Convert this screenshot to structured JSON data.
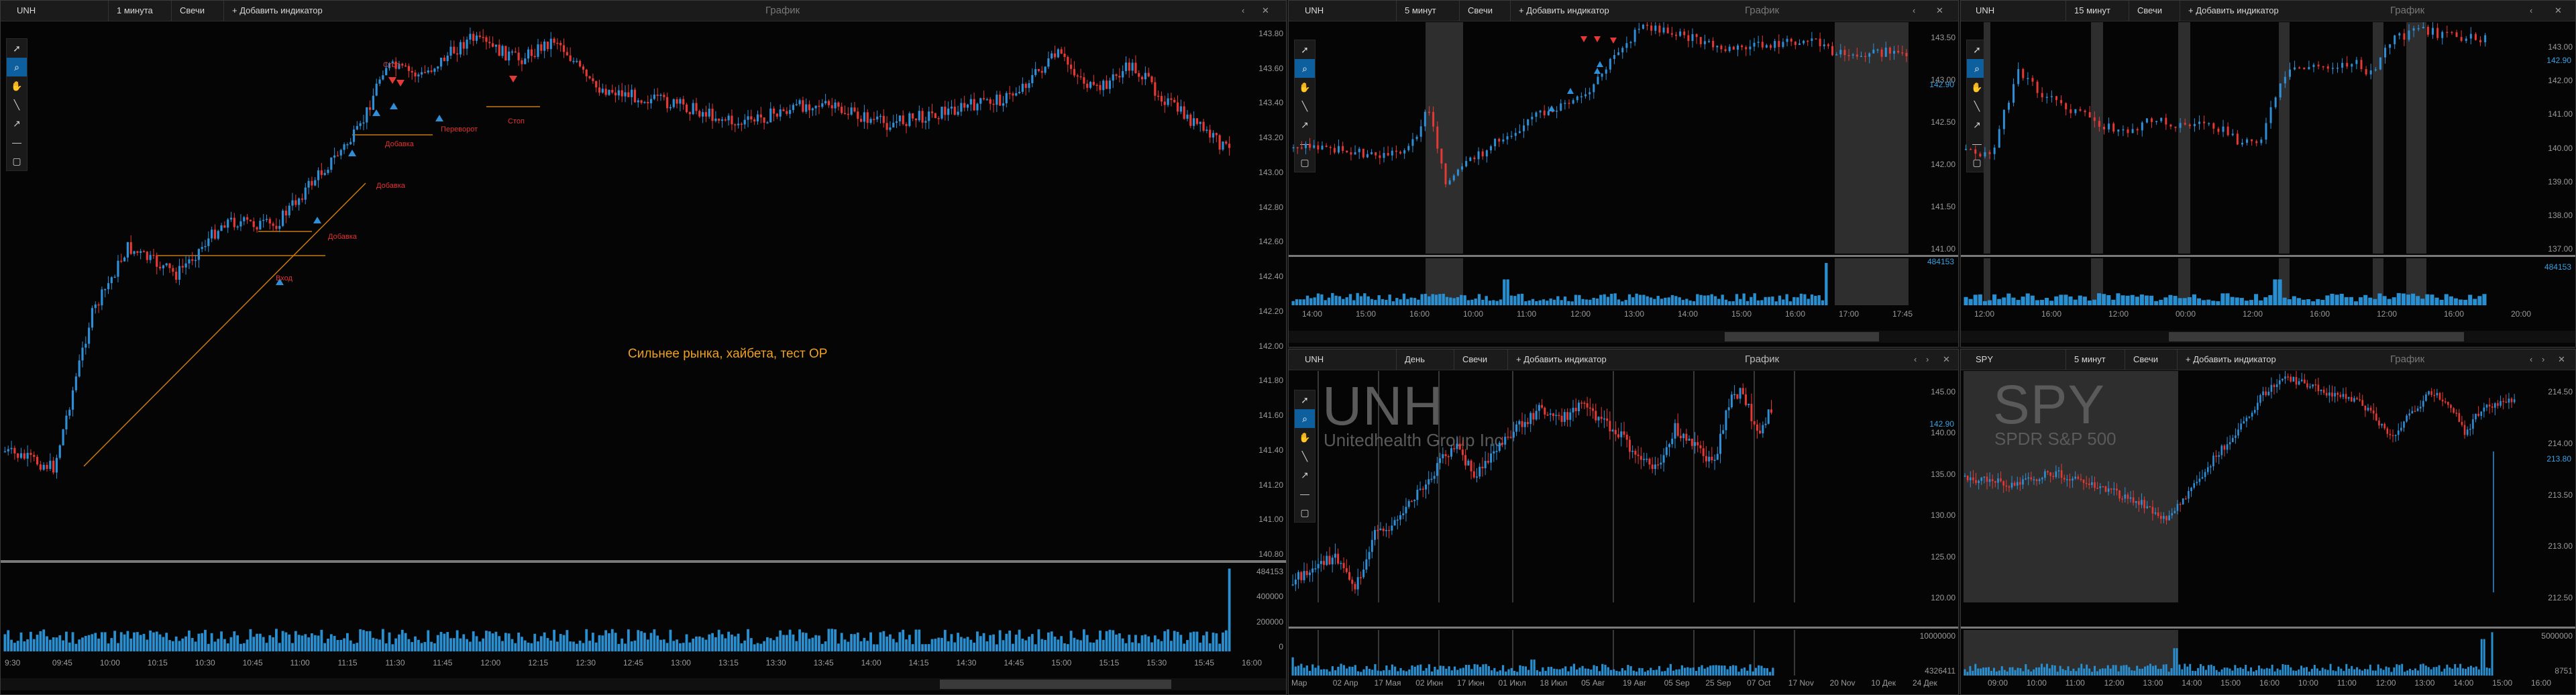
{
  "panels": {
    "p1": {
      "symbol": "UNH",
      "interval": "1 минута",
      "type": "Свечи",
      "add_indicator": "+ Добавить индикатор",
      "title": "График",
      "y_ticks": [
        "143.80",
        "143.60",
        "143.40",
        "143.20",
        "143.00",
        "142.80",
        "142.60",
        "142.40",
        "142.20",
        "142.00",
        "141.80",
        "141.60",
        "141.40",
        "141.20",
        "141.00",
        "140.80"
      ],
      "vol_ticks": [
        "484153",
        "400000",
        "200000",
        "0"
      ],
      "x_ticks": [
        "9:30",
        "09:45",
        "10:00",
        "10:15",
        "10:30",
        "10:45",
        "11:00",
        "11:15",
        "11:30",
        "11:45",
        "12:00",
        "12:15",
        "12:30",
        "12:45",
        "13:00",
        "13:15",
        "13:30",
        "13:45",
        "14:00",
        "14:15",
        "14:30",
        "14:45",
        "15:00",
        "15:15",
        "15:30",
        "15:45",
        "16:00"
      ],
      "note": "Сильнее рынка, хайбета, тест ОР",
      "annotations": [
        "Стоп",
        "Добавка",
        "Переворот",
        "Стоп",
        "Добавка",
        "Добавка",
        "Вход"
      ]
    },
    "p2": {
      "symbol": "UNH",
      "interval": "5 минут",
      "type": "Свечи",
      "add_indicator": "+ Добавить индикатор",
      "title": "График",
      "y_ticks": [
        "143.50",
        "143.00",
        "142.50",
        "142.00",
        "141.50",
        "141.00"
      ],
      "price_tag": "142.90",
      "vol_tag": "484153",
      "x_ticks": [
        "14:00",
        "15:00",
        "16:00",
        "10:00",
        "11:00",
        "12:00",
        "13:00",
        "14:00",
        "15:00",
        "16:00",
        "17:00",
        "17:45"
      ]
    },
    "p3": {
      "symbol": "UNH",
      "interval": "15 минут",
      "type": "Свечи",
      "add_indicator": "+ Добавить индикатор",
      "title": "График",
      "y_ticks": [
        "143.00",
        "142.00",
        "141.00",
        "140.00",
        "139.00",
        "138.00",
        "137.00"
      ],
      "price_tag": "142.90",
      "vol_tag": "484153",
      "x_ticks": [
        "12:00",
        "16:00",
        "12:00",
        "00:00",
        "12:00",
        "16:00",
        "12:00",
        "16:00",
        "20:00"
      ]
    },
    "p4": {
      "symbol": "UNH",
      "interval": "День",
      "type": "Свечи",
      "add_indicator": "+ Добавить индикатор",
      "title": "График",
      "big_symbol": "UNH",
      "company": "Unitedhealth Group Inc",
      "y_ticks": [
        "145.00",
        "140.00",
        "135.00",
        "130.00",
        "125.00",
        "120.00"
      ],
      "price_tag": "142.90",
      "vol_ticks": [
        "10000000",
        "4326411"
      ],
      "x_ticks": [
        "Мар",
        "02 Апр",
        "17 Мая",
        "02 Июн",
        "17 Июн",
        "01 Июл",
        "18 Июл",
        "05 Авг",
        "19 Авг",
        "05 Sep",
        "25 Sep",
        "07 Oct",
        "17 Nov",
        "20 Nov",
        "10 Дек",
        "24 Дек"
      ]
    },
    "p5": {
      "symbol": "SPY",
      "interval": "5 минут",
      "type": "Свечи",
      "add_indicator": "+ Добавить индикатор",
      "title": "График",
      "big_symbol": "SPY",
      "company": "SPDR S&P 500",
      "y_ticks": [
        "214.50",
        "214.00",
        "213.50",
        "213.00",
        "212.50"
      ],
      "price_tag": "213.80",
      "vol_ticks": [
        "5000000",
        "8751"
      ],
      "x_ticks": [
        "09:00",
        "10:00",
        "11:00",
        "12:00",
        "13:00",
        "14:00",
        "15:00",
        "16:00",
        "10:00",
        "11:00",
        "12:00",
        "13:00",
        "14:00",
        "15:00",
        "16:00"
      ]
    }
  },
  "toolbar_icons": [
    "cursor-icon",
    "zoom-icon",
    "hand-icon",
    "line-icon",
    "arrow-icon",
    "hline-icon",
    "rect-icon"
  ],
  "colors": {
    "up": "#2f8fd6",
    "down": "#e53935",
    "volume": "#2a8fd0",
    "accent": "#0d5f9e"
  }
}
